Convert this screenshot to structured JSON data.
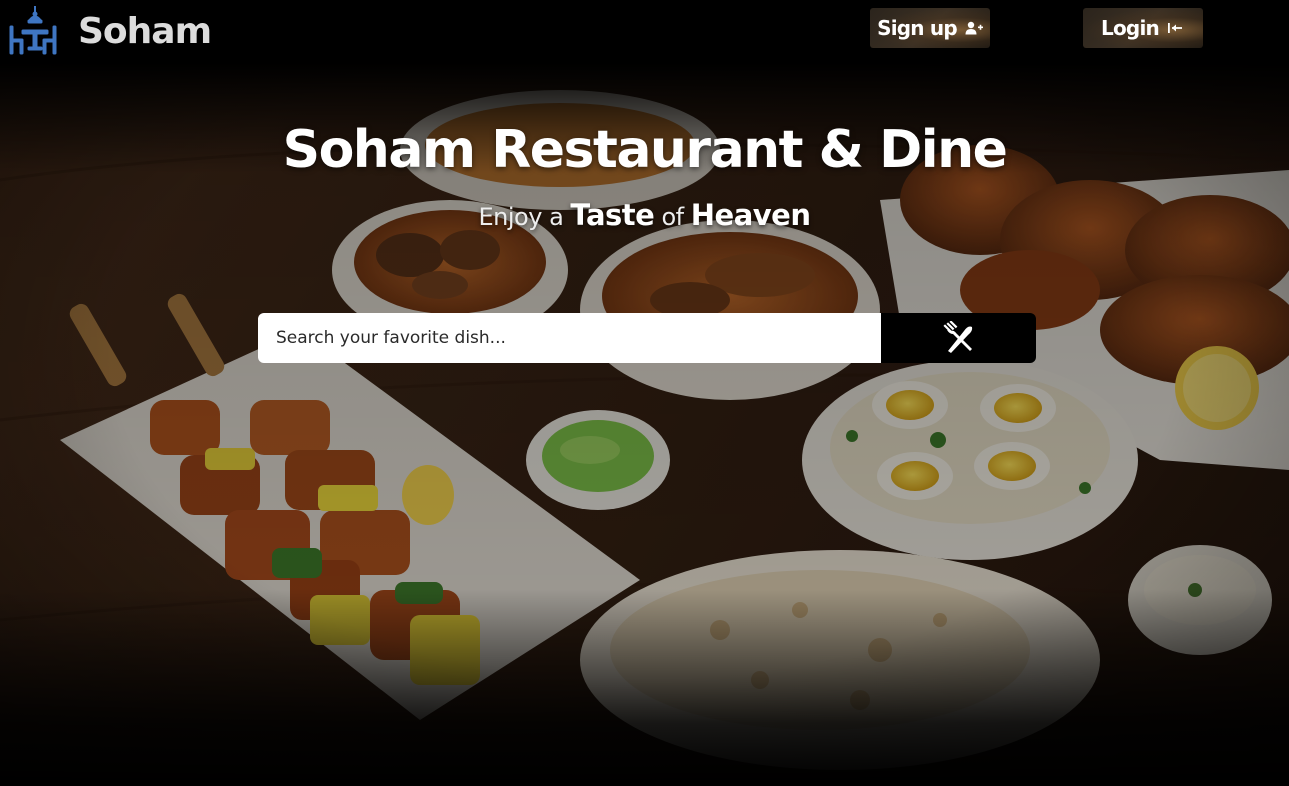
{
  "brand": {
    "name": "Soham",
    "logo_icon": "dining-table-icon"
  },
  "nav": {
    "signup_label": "Sign up",
    "signup_icon": "user-plus-icon",
    "login_label": "Login",
    "login_icon": "login-arrow-icon"
  },
  "hero": {
    "title": "Soham Restaurant & Dine",
    "tagline": {
      "w1": "Enjoy a",
      "w2": "Taste",
      "w3": "of",
      "w4": "Heaven"
    },
    "background_image": "indian-food-spread"
  },
  "search": {
    "placeholder": "Search your favorite dish...",
    "value": "",
    "button_icon": "fork-knife-icon"
  },
  "colors": {
    "page_background": "#000000",
    "brand_text": "#dcdcdc",
    "heading_text": "#ffffff",
    "search_button": "#000000",
    "logo_blue": "#3f76c2"
  }
}
